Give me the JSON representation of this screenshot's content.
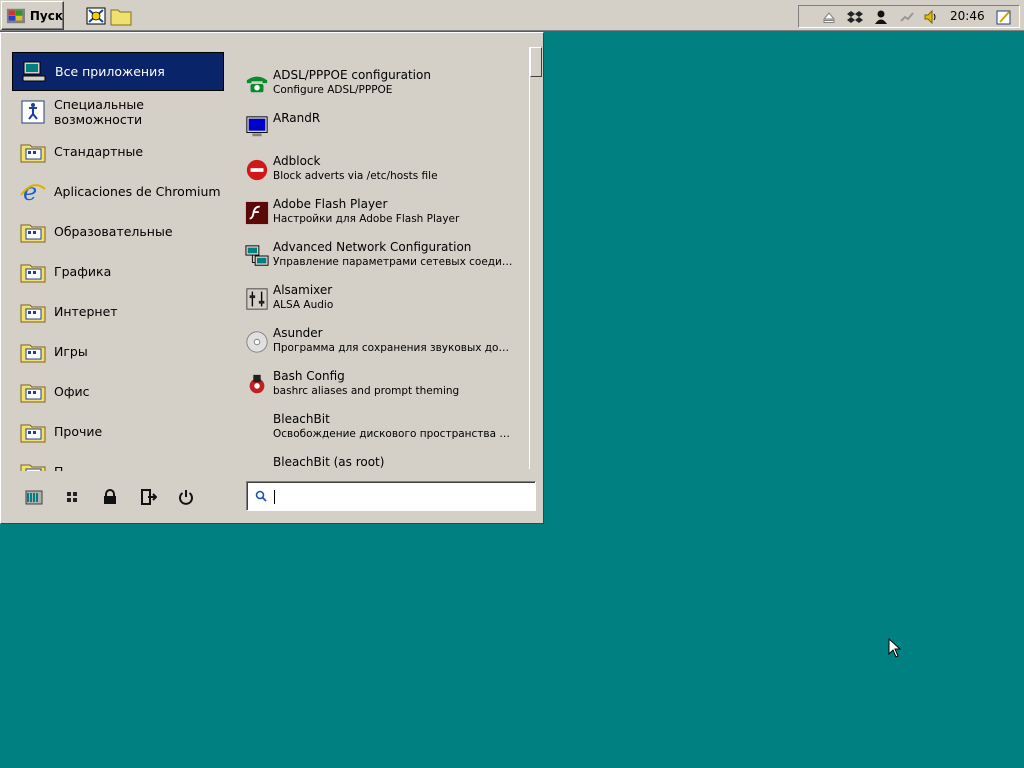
{
  "taskbar": {
    "start_label": "Пуск",
    "clock": "20:46",
    "quick_launch": [
      "desktop-icon",
      "folder-icon"
    ],
    "tray": [
      "eject-icon",
      "dropbox-icon",
      "user-icon",
      "network-icon",
      "volume-icon",
      "notes-icon"
    ]
  },
  "menu": {
    "categories": [
      {
        "label": "Все приложения",
        "icon": "computer-icon",
        "selected": true
      },
      {
        "label": "Специальные возможности",
        "icon": "accessibility-icon"
      },
      {
        "label": "Стандартные",
        "icon": "folder-icon"
      },
      {
        "label": "Aplicaciones de Chromium",
        "icon": "ie-icon"
      },
      {
        "label": "Образовательные",
        "icon": "folder-icon"
      },
      {
        "label": "Графика",
        "icon": "folder-icon"
      },
      {
        "label": "Интернет",
        "icon": "folder-icon"
      },
      {
        "label": "Игры",
        "icon": "folder-icon"
      },
      {
        "label": "Офис",
        "icon": "folder-icon"
      },
      {
        "label": "Прочие",
        "icon": "folder-icon"
      },
      {
        "label": "П",
        "icon": "folder-icon"
      }
    ],
    "apps": [
      {
        "name": "ADSL/PPPOE configuration",
        "desc": "Configure ADSL/PPPOE",
        "icon": "phone-icon"
      },
      {
        "name": "ARandR",
        "desc": "",
        "icon": "monitor-icon"
      },
      {
        "name": "Adblock",
        "desc": "Block adverts via /etc/hosts file",
        "icon": "stop-icon"
      },
      {
        "name": "Adobe Flash Player",
        "desc": "Настройки для Adobe Flash Player",
        "icon": "flash-icon"
      },
      {
        "name": "Advanced Network Configuration",
        "desc": "Управление параметрами сетевых соедине...",
        "icon": "network-config-icon"
      },
      {
        "name": "Alsamixer",
        "desc": "ALSA Audio",
        "icon": "mixer-icon"
      },
      {
        "name": "Asunder",
        "desc": "Программа для сохранения звуковых дорож...",
        "icon": "cd-icon"
      },
      {
        "name": "Bash Config",
        "desc": "bashrc aliases and prompt theming",
        "icon": "gear-icon"
      },
      {
        "name": "BleachBit",
        "desc": "Освобождение дискового пространства и о...",
        "icon": ""
      },
      {
        "name": "BleachBit (as root)",
        "desc": "",
        "icon": ""
      }
    ],
    "search": {
      "value": "",
      "placeholder": ""
    },
    "bottom_actions": [
      "system-settings-icon",
      "apps-grid-icon",
      "lock-icon",
      "logout-icon",
      "power-icon"
    ]
  }
}
